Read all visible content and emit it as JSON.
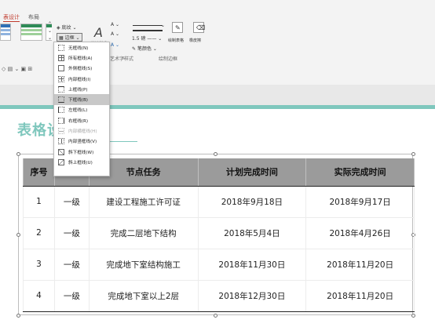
{
  "ribbon": {
    "tabs": [
      {
        "label": "表设计",
        "active": true
      },
      {
        "label": "布局",
        "active": false
      }
    ],
    "shading_label": "底纹",
    "borders_label": "边框",
    "wordart_group_label": "艺术字样式",
    "pen_weight": "1.5 磅",
    "pen_color_label": "笔颜色",
    "draw_table_label": "绘制表格",
    "eraser_label": "橡皮擦",
    "draw_borders_group_label": "绘制边框"
  },
  "slide": {
    "title": "表格设"
  },
  "border_menu": {
    "items": [
      {
        "label": "无框线(N)",
        "icon": "border-none-icon",
        "highlighted": false,
        "disabled": false
      },
      {
        "label": "所有框线(A)",
        "icon": "border-all-icon",
        "highlighted": false,
        "disabled": false
      },
      {
        "label": "外侧框线(S)",
        "icon": "border-outside-icon",
        "highlighted": false,
        "disabled": false
      },
      {
        "label": "内部框线(I)",
        "icon": "border-inside-icon",
        "highlighted": false,
        "disabled": false
      },
      {
        "label": "上框线(P)",
        "icon": "border-top-icon",
        "highlighted": false,
        "disabled": false
      },
      {
        "label": "下框线(B)",
        "icon": "border-bottom-icon",
        "highlighted": true,
        "disabled": false
      },
      {
        "label": "左框线(L)",
        "icon": "border-left-icon",
        "highlighted": false,
        "disabled": false
      },
      {
        "label": "右框线(R)",
        "icon": "border-right-icon",
        "highlighted": false,
        "disabled": false
      },
      {
        "label": "内部横框线(H)",
        "icon": "border-inside-horizontal-icon",
        "highlighted": false,
        "disabled": true
      },
      {
        "label": "内部竖框线(V)",
        "icon": "border-inside-vertical-icon",
        "highlighted": false,
        "disabled": false
      },
      {
        "label": "斜下框线(W)",
        "icon": "diagonal-down-border-icon",
        "highlighted": false,
        "disabled": false
      },
      {
        "label": "斜上框线(U)",
        "icon": "diagonal-up-border-icon",
        "highlighted": false,
        "disabled": false
      }
    ]
  },
  "table": {
    "headers": [
      "序号",
      "",
      "节点任务",
      "计划完成时间",
      "实际完成时间"
    ],
    "rows": [
      [
        "1",
        "一级",
        "建设工程施工许可证",
        "2018年9月18日",
        "2018年9月17日"
      ],
      [
        "2",
        "一级",
        "完成二层地下结构",
        "2018年5月4日",
        "2018年4月26日"
      ],
      [
        "3",
        "一级",
        "完成地下室结构施工",
        "2018年11月30日",
        "2018年11月20日"
      ],
      [
        "4",
        "一级",
        "完成地下室以上2层",
        "2018年12月30日",
        "2018年11月20日"
      ]
    ]
  },
  "colors": {
    "accent": "#7fc7bd",
    "header_fill": "#9b9b9b",
    "tab_active": "#c0392b"
  }
}
